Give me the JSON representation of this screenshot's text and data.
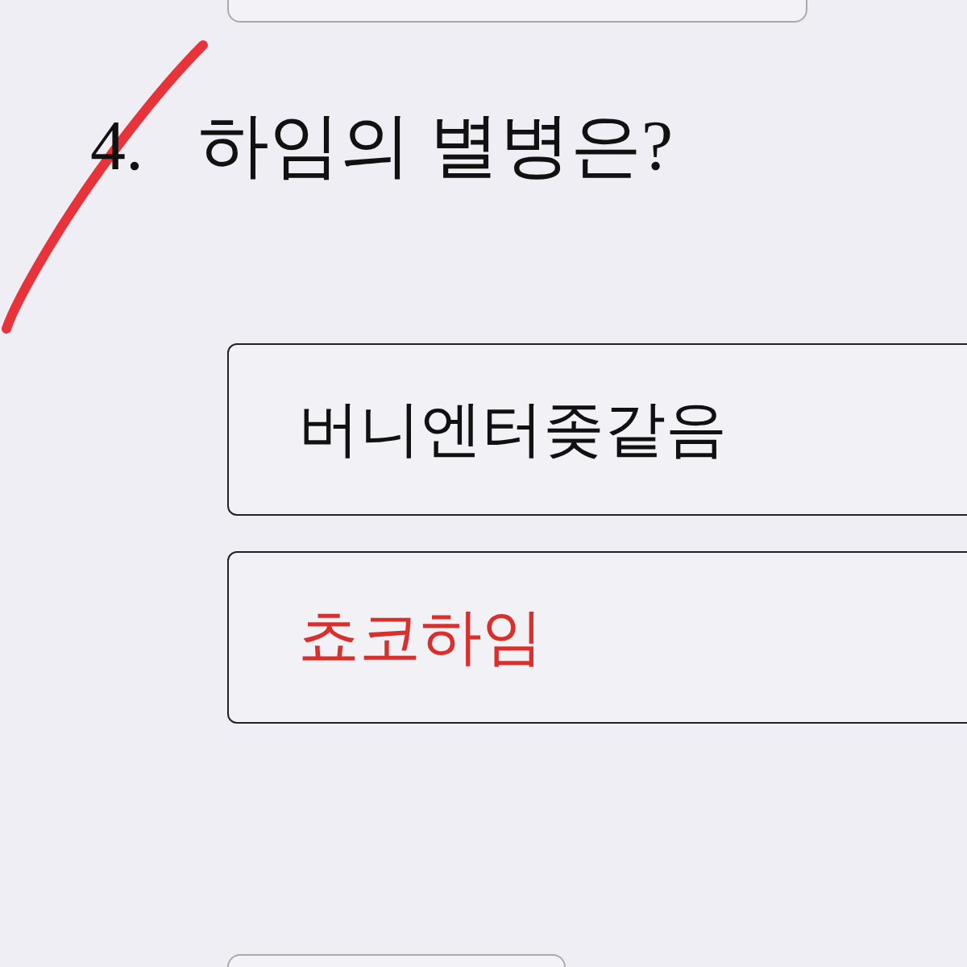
{
  "question": {
    "number": "4.",
    "text": "하임의 별병은?",
    "marked_wrong": true
  },
  "options": [
    {
      "label": "버니엔터좆같음",
      "selected": false
    },
    {
      "label": "쵸코하임",
      "selected": true
    }
  ]
}
